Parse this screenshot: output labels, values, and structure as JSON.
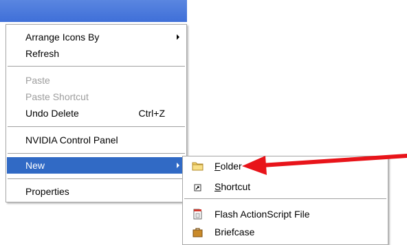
{
  "context_menu": {
    "items": [
      {
        "label": "Arrange Icons By",
        "has_submenu": true
      },
      {
        "label": "Refresh"
      },
      {
        "label": "Paste",
        "disabled": true
      },
      {
        "label": "Paste Shortcut",
        "disabled": true
      },
      {
        "label": "Undo Delete",
        "shortcut": "Ctrl+Z"
      },
      {
        "label": "NVIDIA Control Panel"
      },
      {
        "label": "New",
        "has_submenu": true,
        "selected": true
      },
      {
        "label": "Properties"
      }
    ]
  },
  "new_submenu": {
    "items": [
      {
        "label_access": "F",
        "label_rest": "older",
        "icon": "folder-icon"
      },
      {
        "label_access": "S",
        "label_rest": "hortcut",
        "icon": "shortcut-icon"
      },
      {
        "label": "Flash ActionScript File",
        "icon": "actionscript-file-icon"
      },
      {
        "label": "Briefcase",
        "icon": "briefcase-icon"
      }
    ]
  },
  "colors": {
    "selection": "#316ac5",
    "desktop": "#3f6fd8",
    "annotation_arrow": "#e8141a"
  }
}
